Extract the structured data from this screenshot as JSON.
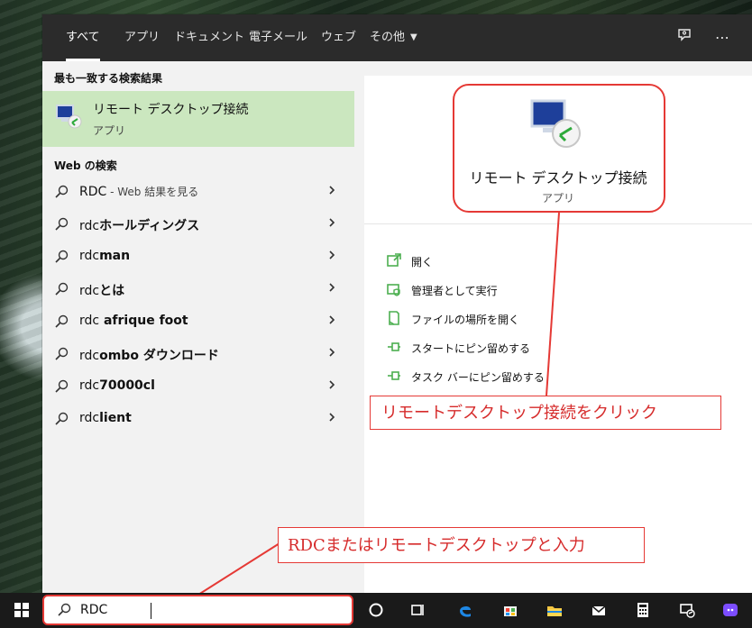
{
  "search_panel": {
    "tabs": [
      {
        "label": "すべて"
      },
      {
        "label": "アプリ"
      },
      {
        "label": "ドキュメント"
      },
      {
        "label": "電子メール"
      },
      {
        "label": "ウェブ"
      },
      {
        "label": "その他"
      }
    ],
    "more_icon": "ellipsis-icon",
    "feedback_icon": "feedback-icon",
    "best_match_title": "最も一致する検索結果",
    "best_match": {
      "title": "リモート デスクトップ接続",
      "subtitle": "アプリ",
      "icon": "remote-desktop-icon"
    },
    "web_search_title": "Web の検索",
    "web_results": [
      {
        "prefix": "RDC",
        "suffix": " - Web 結果を見る",
        "bold": false
      },
      {
        "prefix": "rdc",
        "suffix": "ホールディングス",
        "bold": true
      },
      {
        "prefix": "rdc",
        "suffix": "man",
        "bold": true
      },
      {
        "prefix": "rdc",
        "suffix": "とは",
        "bold": true
      },
      {
        "prefix": "rdc",
        "suffix": " afrique foot",
        "bold": true
      },
      {
        "prefix": "rdc",
        "suffix": "ombo ダウンロード",
        "bold": true
      },
      {
        "prefix": "rdc",
        "suffix": "70000cl",
        "bold": true
      },
      {
        "prefix": "rdc",
        "suffix": "lient",
        "bold": true
      }
    ],
    "details": {
      "title": "リモート デスクトップ接続",
      "subtitle": "アプリ",
      "actions": [
        {
          "label": "開く",
          "icon": "open-icon"
        },
        {
          "label": "管理者として実行",
          "icon": "admin-icon"
        },
        {
          "label": "ファイルの場所を開く",
          "icon": "file-location-icon"
        },
        {
          "label": "スタートにピン留めする",
          "icon": "pin-start-icon"
        },
        {
          "label": "タスク バーにピン留めする",
          "icon": "pin-taskbar-icon"
        }
      ]
    }
  },
  "taskbar": {
    "search_value": "RDC",
    "icons": [
      "windows-start-icon",
      "cortana-icon",
      "task-view-icon",
      "edge-icon",
      "store-icon",
      "file-explorer-icon",
      "mail-icon",
      "calculator-icon",
      "remote-desktop-taskbar-icon",
      "discord-icon"
    ]
  },
  "annotations": {
    "click_note": "リモートデスクトップ接続をクリック",
    "type_note": "RDCまたはリモートデスクトップと入力"
  },
  "colors": {
    "accent_green": "#cbe7bf",
    "annotation_red": "#d62b2b",
    "nav_bg": "#2b2b2b",
    "taskbar_bg": "#1a1a1a",
    "action_icon_green": "#4caf50"
  }
}
